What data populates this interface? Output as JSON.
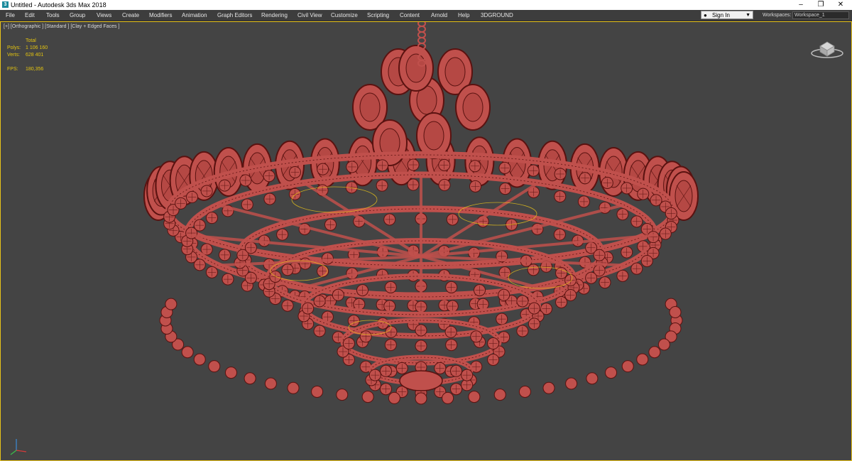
{
  "window": {
    "title": "Untitled - Autodesk 3ds Max 2018",
    "icon": "3ds-max-app-icon",
    "controls": [
      "minimize",
      "restore",
      "close"
    ]
  },
  "menu": {
    "items": [
      "File",
      "Edit",
      "Tools",
      "Group",
      "Views",
      "Create",
      "Modifiers",
      "Animation",
      "Graph Editors",
      "Rendering",
      "Civil View",
      "Customize",
      "Scripting",
      "Content",
      "Arnold",
      "Help",
      "3DGROUND"
    ],
    "signin_label": "Sign In",
    "workspaces_label": "Workspaces:",
    "workspace_value": "Workspace_1"
  },
  "viewport": {
    "label": "[+] [Orthographic ] [Standard ] [Clay + Edged Faces ]",
    "stats": {
      "header": "Total",
      "polys_label": "Polys:",
      "polys_value": "1 106 160",
      "verts_label": "Verts:",
      "verts_value": "628 401",
      "fps_label": "FPS:",
      "fps_value": "180,356"
    },
    "colors": {
      "background": "#444444",
      "model": "#c0504c",
      "wire": "#5a1210",
      "highlight": "#e8c31a",
      "stats_text": "#e4c40f"
    }
  }
}
